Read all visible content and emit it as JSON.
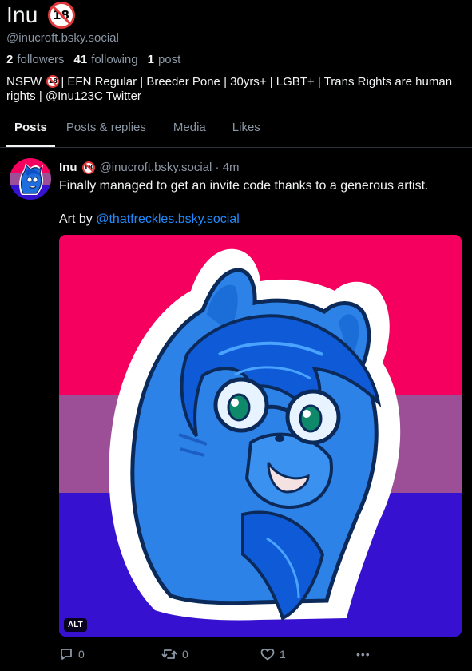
{
  "profile": {
    "display_name": "Inu",
    "age_badge": "18",
    "handle": "@inucroft.bsky.social",
    "stats": {
      "followers_count": "2",
      "followers_label": "followers",
      "following_count": "41",
      "following_label": "following",
      "posts_count": "1",
      "posts_label": "post"
    },
    "bio": {
      "part1": "NSFW",
      "part2": "| EFN Regular | Breeder Pone | 30yrs+ | LGBT+ | Trans Rights are human rights | @Inu123C Twitter"
    }
  },
  "tabs": [
    {
      "label": "Posts",
      "active": true
    },
    {
      "label": "Posts & replies",
      "active": false
    },
    {
      "label": "Media",
      "active": false
    },
    {
      "label": "Likes",
      "active": false
    }
  ],
  "post": {
    "author_name": "Inu",
    "author_handle": "@inucroft.bsky.social",
    "separator": "·",
    "timestamp": "4m",
    "text_line1": "Finally managed to get an invite code thanks to a generous artist.",
    "text_line2_prefix": "Art by ",
    "text_line2_mention": "@thatfreckles.bsky.social",
    "image_alt_badge": "ALT",
    "reply_count": "0",
    "repost_count": "0",
    "like_count": "1",
    "more_label": "•••"
  },
  "colors": {
    "background": "#000000",
    "text_primary": "#f1f3f5",
    "text_secondary": "#8c97a4",
    "link": "#208bfe",
    "bi_pink": "#f5005f",
    "bi_purple": "#9c4f96",
    "bi_blue": "#3611d0"
  },
  "icons": [
    "no-under-18-icon",
    "reply-icon",
    "repost-icon",
    "like-heart-icon",
    "more-icon"
  ]
}
